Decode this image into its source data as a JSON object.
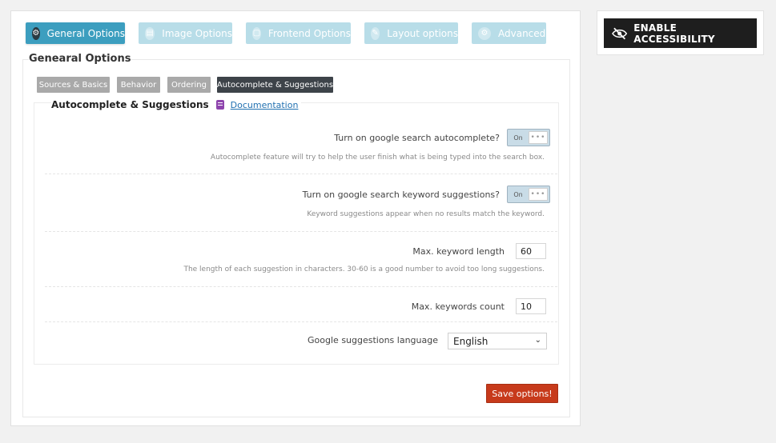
{
  "main_tabs": [
    {
      "label": "General Options",
      "icon": "gear-icon",
      "active": true
    },
    {
      "label": "Image Options",
      "icon": "image-icon",
      "active": false
    },
    {
      "label": "Frontend Options",
      "icon": "frontend-icon",
      "active": false
    },
    {
      "label": "Layout options",
      "icon": "pencil-icon",
      "active": false
    },
    {
      "label": "Advanced",
      "icon": "gears-icon",
      "active": false
    }
  ],
  "section_title": "Genearal Options",
  "sub_tabs": [
    {
      "label": "Sources & Basics",
      "active": false
    },
    {
      "label": "Behavior",
      "active": false
    },
    {
      "label": "Ordering",
      "active": false
    },
    {
      "label": "Autocomplete & Suggestions",
      "active": true
    }
  ],
  "panel": {
    "title": "Autocomplete & Suggestions",
    "doc_link": "Documentation"
  },
  "options": {
    "autocomplete": {
      "label": "Turn on google search autocomplete?",
      "toggle_text": "On",
      "description": "Autocomplete feature will try to help the user finish what is being typed into the search box."
    },
    "keyword_suggestions": {
      "label": "Turn on google search keyword suggestions?",
      "toggle_text": "On",
      "description": "Keyword suggestions appear when no results match the keyword."
    },
    "max_keyword_length": {
      "label": "Max. keyword length",
      "value": "60",
      "description": "The length of each suggestion in characters. 30-60 is a good number to avoid too long suggestions."
    },
    "max_keywords_count": {
      "label": "Max. keywords count",
      "value": "10"
    },
    "suggestions_language": {
      "label": "Google suggestions language",
      "value": "English"
    }
  },
  "save_button": "Save options!",
  "accessibility_button": "ENABLE ACCESSIBILITY",
  "colors": {
    "accent": "#3c9ebf",
    "tab_inactive": "#b8dde8",
    "save": "#c73a1b",
    "doc_icon": "#8e44ad"
  }
}
